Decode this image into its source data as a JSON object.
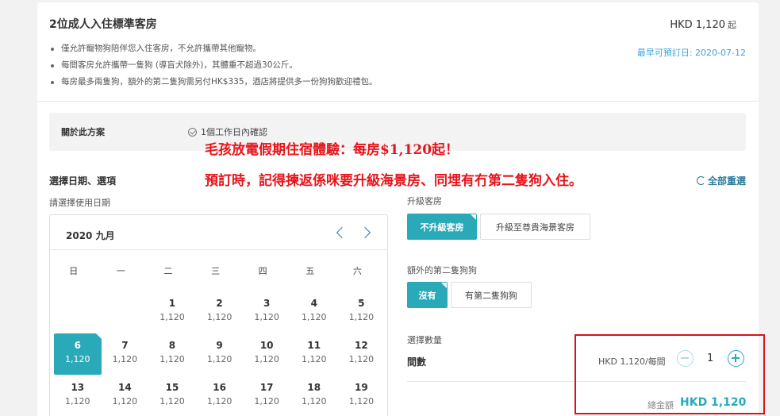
{
  "room": {
    "title": "2位成人入住標準客房",
    "price_label": "HKD 1,120",
    "price_suffix": "起",
    "earliest": "最早可預訂日: 2020-07-12",
    "bullets": [
      "僅允許寵物狗陪伴您入住客房，不允許攜帶其他寵物。",
      "每間客房允許攜帶一隻狗 (導盲犬除外)，其體重不超過30公斤。",
      "每房最多兩隻狗，額外的第二隻狗需另付HK$335，酒店將提供多一份狗狗歡迎禮包。"
    ]
  },
  "about": {
    "label": "關於此方案",
    "value": "1個工作日內確認"
  },
  "promo": {
    "line1": "毛孩放電假期住宿體驗：每房$1,120起！",
    "line2": "預訂時，記得揀返係咪要升級海景房、同埋有冇第二隻狗入住。"
  },
  "section": {
    "title": "選擇日期、選項",
    "reset": "全部重選",
    "date_label": "請選擇使用日期"
  },
  "calendar": {
    "month": "2020 九月",
    "weekdays": [
      "日",
      "一",
      "二",
      "三",
      "四",
      "五",
      "六"
    ],
    "weeks": [
      [
        null,
        null,
        {
          "d": "1",
          "p": "1,120"
        },
        {
          "d": "2",
          "p": "1,120"
        },
        {
          "d": "3",
          "p": "1,120"
        },
        {
          "d": "4",
          "p": "1,120"
        },
        {
          "d": "5",
          "p": "1,120"
        }
      ],
      [
        {
          "d": "6",
          "p": "1,120",
          "sel": true
        },
        {
          "d": "7",
          "p": "1,120"
        },
        {
          "d": "8",
          "p": "1,120"
        },
        {
          "d": "9",
          "p": "1,120"
        },
        {
          "d": "10",
          "p": "1,120"
        },
        {
          "d": "11",
          "p": "1,120"
        },
        {
          "d": "12",
          "p": "1,120"
        }
      ],
      [
        {
          "d": "13",
          "p": "1,120"
        },
        {
          "d": "14",
          "p": "1,120"
        },
        {
          "d": "15",
          "p": "1,120"
        },
        {
          "d": "16",
          "p": "1,120"
        },
        {
          "d": "17",
          "p": "1,120"
        },
        {
          "d": "18",
          "p": "1,120"
        },
        {
          "d": "19",
          "p": "1,120"
        }
      ]
    ]
  },
  "options": {
    "upgrade_label": "升級客房",
    "upgrade_no": "不升級客房",
    "upgrade_yes": "升級至尊貴海景客房",
    "dog_label": "額外的第二隻狗狗",
    "dog_no": "沒有",
    "dog_yes": "有第二隻狗狗"
  },
  "quantity": {
    "label": "選擇數量",
    "room_label": "間數",
    "unit_price": "HKD 1,120/每間",
    "value": "1"
  },
  "total": {
    "label": "總金額",
    "value": "HKD 1,120"
  },
  "colors": {
    "accent": "#2aaab9",
    "link": "#3da4d4",
    "promo": "#e8141b",
    "highlight_box": "#d8141b"
  }
}
